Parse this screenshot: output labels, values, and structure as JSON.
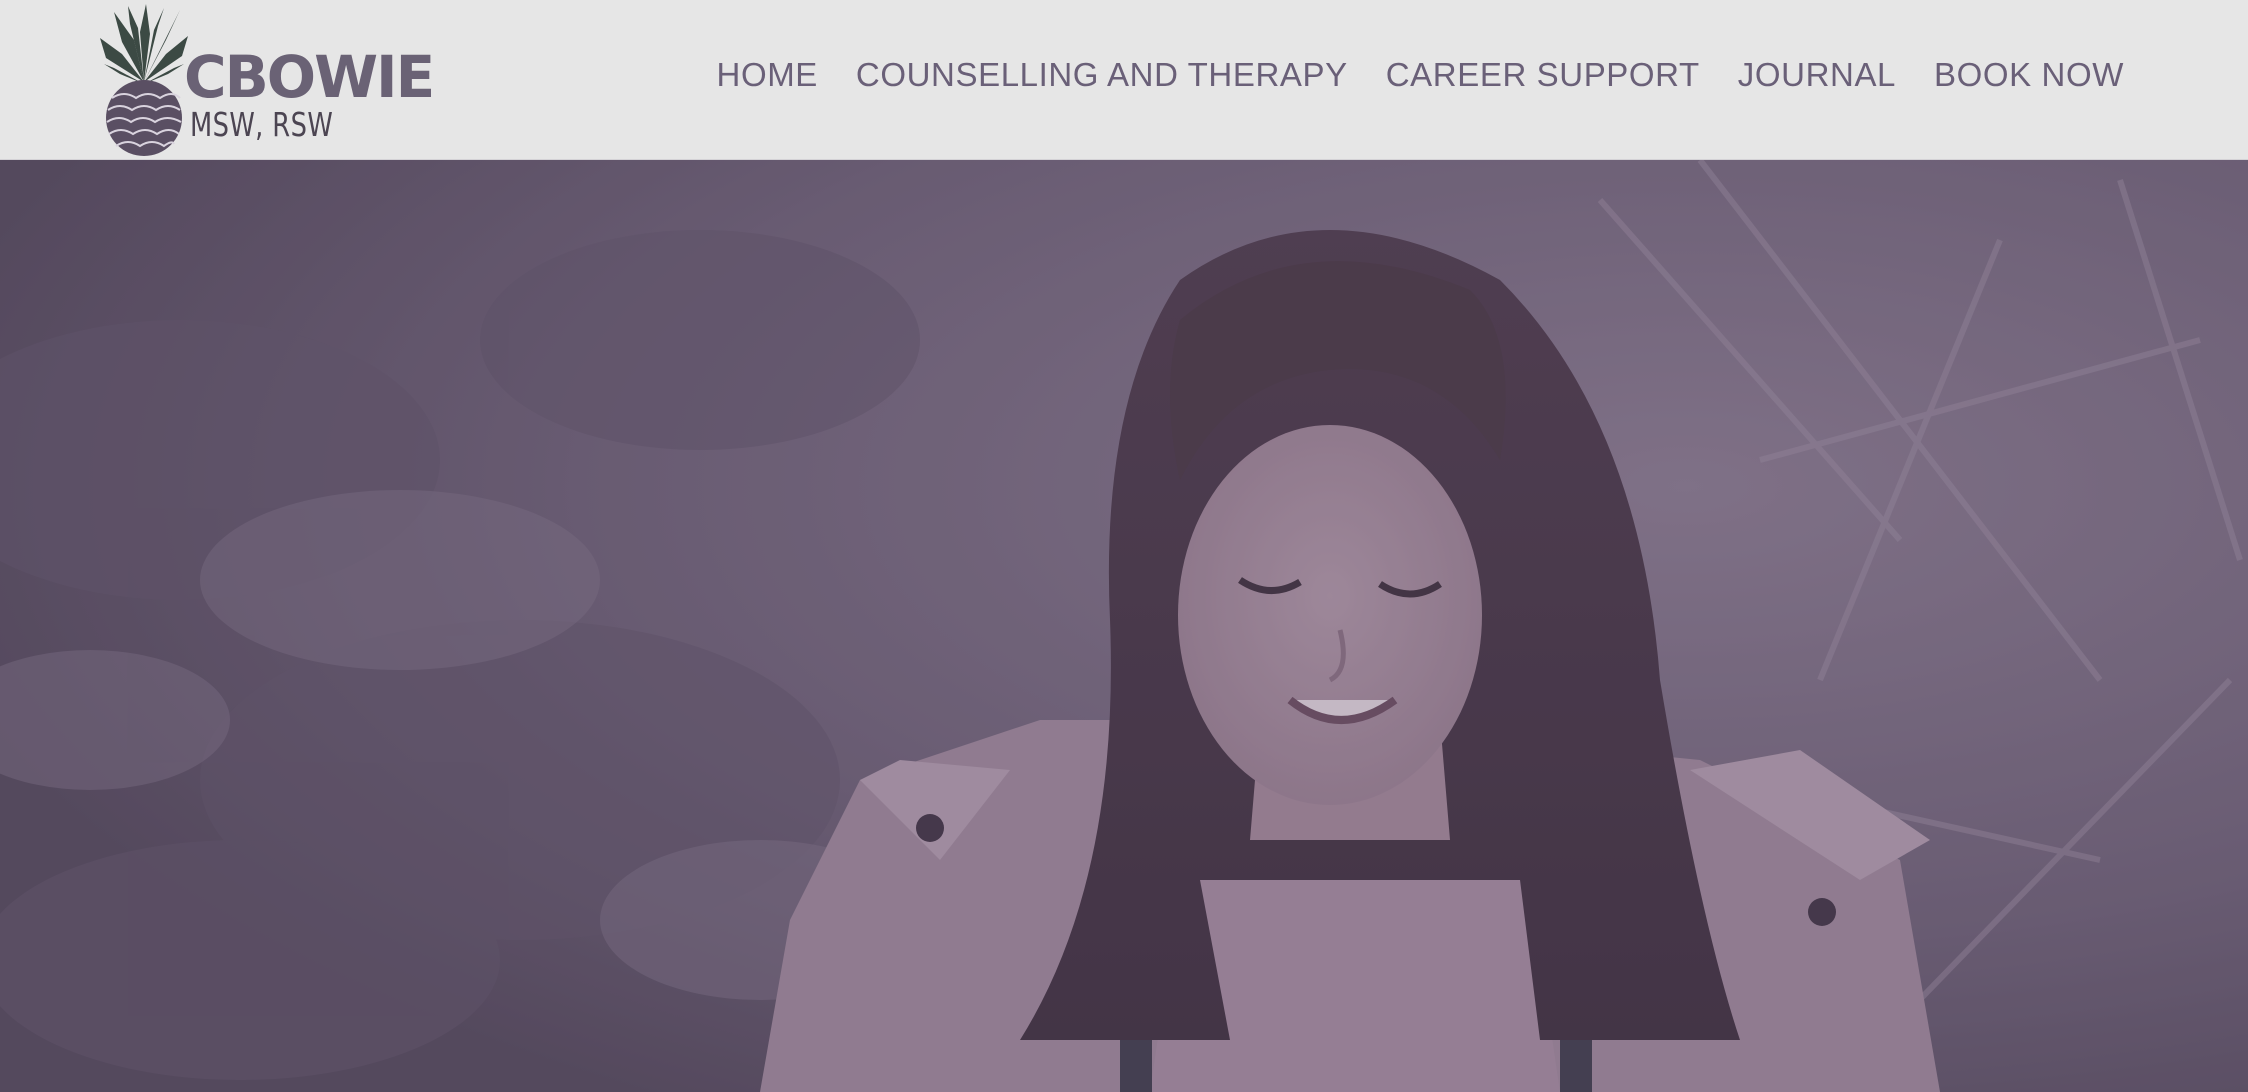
{
  "header": {
    "logo": {
      "icon": "pineapple-icon",
      "name": "CBOWIE",
      "credentials": "MSW, RSW"
    },
    "nav": [
      {
        "label": "HOME"
      },
      {
        "label": "COUNSELLING AND THERAPY"
      },
      {
        "label": "CAREER SUPPORT"
      },
      {
        "label": "JOURNAL"
      },
      {
        "label": "BOOK NOW"
      }
    ]
  },
  "hero": {
    "overlay_color": "#5f4f6b"
  },
  "colors": {
    "header_bg": "#e6e6e6",
    "nav_text": "#6a6078",
    "logo_text": "#6a6275",
    "overlay": "#5f4f6b"
  }
}
